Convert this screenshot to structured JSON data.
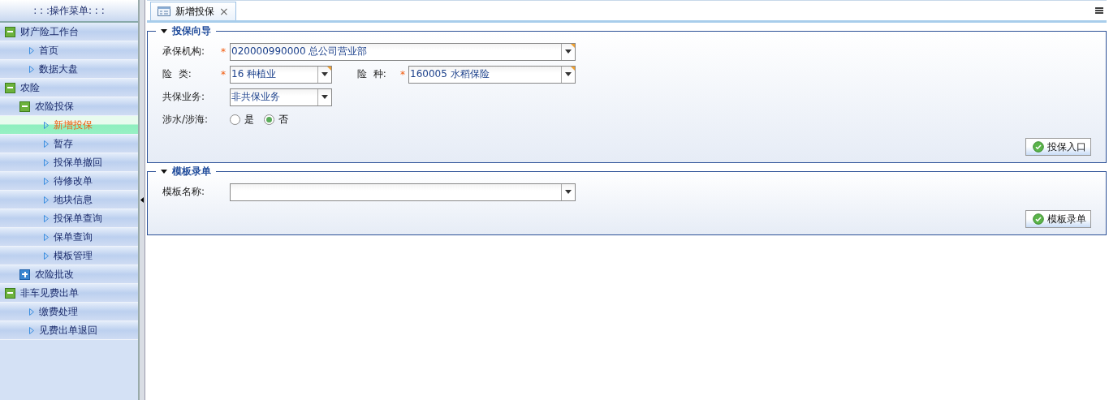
{
  "sidebar": {
    "title": ": : :操作菜单: : :",
    "items": [
      {
        "label": "财产险工作台",
        "expanded": true,
        "children": [
          {
            "label": "首页",
            "selected": false
          },
          {
            "label": "数据大盘",
            "selected": false
          }
        ]
      },
      {
        "label": "农险",
        "expanded": true,
        "children": [
          {
            "label": "农险投保",
            "expanded": true,
            "children": [
              {
                "label": "新增投保",
                "selected": true
              },
              {
                "label": "暂存",
                "selected": false
              },
              {
                "label": "投保单撤回",
                "selected": false
              },
              {
                "label": "待修改单",
                "selected": false
              },
              {
                "label": "地块信息",
                "selected": false
              },
              {
                "label": "投保单查询",
                "selected": false
              },
              {
                "label": "保单查询",
                "selected": false
              },
              {
                "label": "模板管理",
                "selected": false
              }
            ]
          },
          {
            "label": "农险批改",
            "expanded": false
          }
        ]
      },
      {
        "label": "非车见费出单",
        "expanded": true,
        "children": [
          {
            "label": "缴费处理",
            "selected": false
          },
          {
            "label": "见费出单退回",
            "selected": false
          }
        ]
      }
    ]
  },
  "tabs": [
    {
      "label": "新增投保",
      "selected": true,
      "close": "×"
    }
  ],
  "sections": [
    {
      "title": "投保向导",
      "expanded": true,
      "rows": [
        [
          {
            "label": "承保机构:",
            "kind": "select",
            "required_mark": "*",
            "value": "020000990000 总公司营业部"
          }
        ],
        [
          {
            "label": "险  类:",
            "kind": "select",
            "required_mark": "*",
            "value": "16 种植业"
          },
          {
            "label": "险  种:",
            "kind": "select",
            "required_mark": "*",
            "value": "160005 水稻保险"
          }
        ],
        [
          {
            "label": "共保业务:",
            "kind": "select",
            "value": "非共保业务"
          }
        ],
        [
          {
            "label": "涉水/涉海:",
            "kind": "radio",
            "options": [
              {
                "label": "是",
                "selected": false
              },
              {
                "label": "否",
                "selected": true
              }
            ]
          }
        ]
      ],
      "button": "投保入口"
    },
    {
      "title": "模板录单",
      "expanded": true,
      "rows": [
        [
          {
            "label": "模板名称:",
            "kind": "select"
          }
        ]
      ],
      "button": "模板录单"
    }
  ]
}
